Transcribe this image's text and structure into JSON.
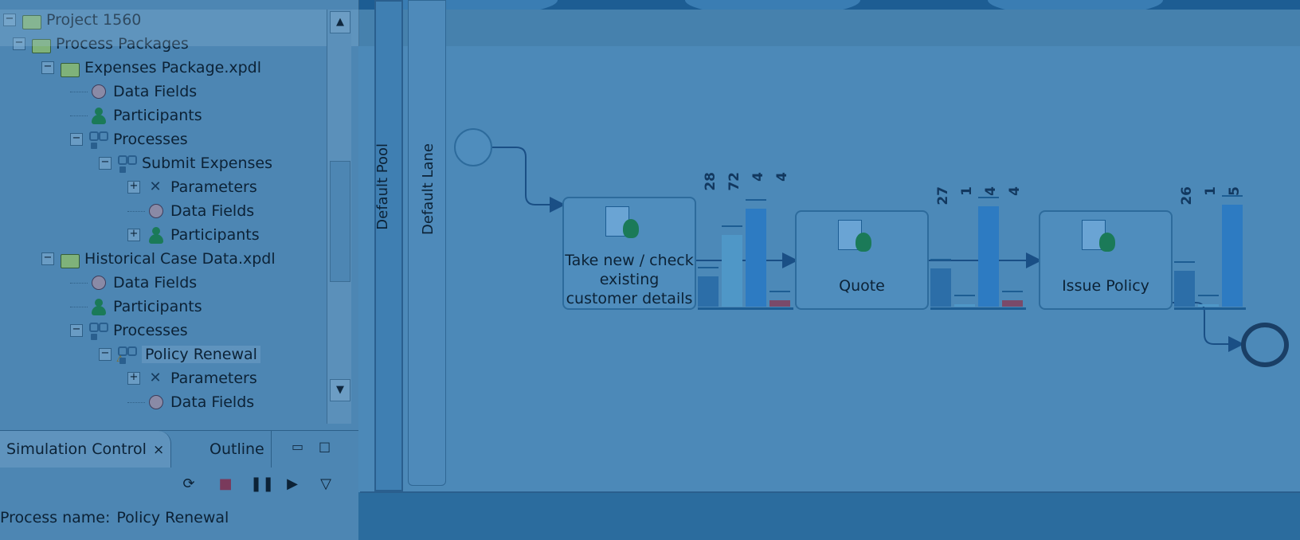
{
  "navigator": {
    "tree": [
      {
        "label": "Project 1560",
        "level": 0,
        "icon": "project-icon",
        "expanded": true
      },
      {
        "label": "Process Packages",
        "level": 1,
        "icon": "folder-icon",
        "expanded": true
      },
      {
        "label": "Expenses Package.xpdl",
        "level": 2,
        "icon": "package-icon",
        "expanded": true
      },
      {
        "label": "Data Fields",
        "level": 3,
        "icon": "data-fields-icon"
      },
      {
        "label": "Participants",
        "level": 3,
        "icon": "participants-icon"
      },
      {
        "label": "Processes",
        "level": 3,
        "icon": "processes-icon",
        "expanded": true
      },
      {
        "label": "Submit Expenses",
        "level": 4,
        "icon": "process-icon",
        "expanded": true
      },
      {
        "label": "Parameters",
        "level": 5,
        "icon": "parameters-icon",
        "expanded": false
      },
      {
        "label": "Data Fields",
        "level": 5,
        "icon": "data-fields-icon"
      },
      {
        "label": "Participants",
        "level": 5,
        "icon": "participants-icon",
        "expanded": false
      },
      {
        "label": "Historical Case Data.xpdl",
        "level": 2,
        "icon": "package-icon",
        "expanded": true
      },
      {
        "label": "Data Fields",
        "level": 3,
        "icon": "data-fields-icon"
      },
      {
        "label": "Participants",
        "level": 3,
        "icon": "participants-icon"
      },
      {
        "label": "Processes",
        "level": 3,
        "icon": "processes-icon",
        "expanded": true
      },
      {
        "label": "Policy Renewal",
        "level": 4,
        "icon": "process-icon",
        "expanded": true,
        "selected": true
      },
      {
        "label": "Parameters",
        "level": 5,
        "icon": "parameters-icon",
        "expanded": false
      },
      {
        "label": "Data Fields",
        "level": 5,
        "icon": "data-fields-icon"
      }
    ]
  },
  "sim_panel": {
    "tab_active": "Simulation Control",
    "tab_other": "Outline",
    "process_name_label": "Process name:",
    "process_name_value": "Policy Renewal"
  },
  "diagram": {
    "pool_label": "Default Pool",
    "lane_label": "Default Lane",
    "tasks": [
      {
        "label": "Take new / check existing customer details"
      },
      {
        "label": "Quote"
      },
      {
        "label": "Issue Policy"
      }
    ],
    "stats": [
      {
        "counts": [
          "28",
          "72",
          "4",
          "4"
        ],
        "heights": [
          0.25,
          0.6,
          0.82,
          0.05
        ]
      },
      {
        "counts": [
          "27",
          "1",
          "4",
          "4"
        ],
        "heights": [
          0.32,
          0.02,
          0.84,
          0.05
        ]
      },
      {
        "counts": [
          "26",
          "1",
          "5"
        ],
        "heights": [
          0.3,
          0.02,
          0.85
        ]
      }
    ]
  },
  "colors": {
    "accent": "#1d5d93",
    "bar1": "#2c6ea8",
    "bar2": "#4f97c7",
    "bar3": "#2d7bc2",
    "bar4": "#7a4a6a"
  }
}
